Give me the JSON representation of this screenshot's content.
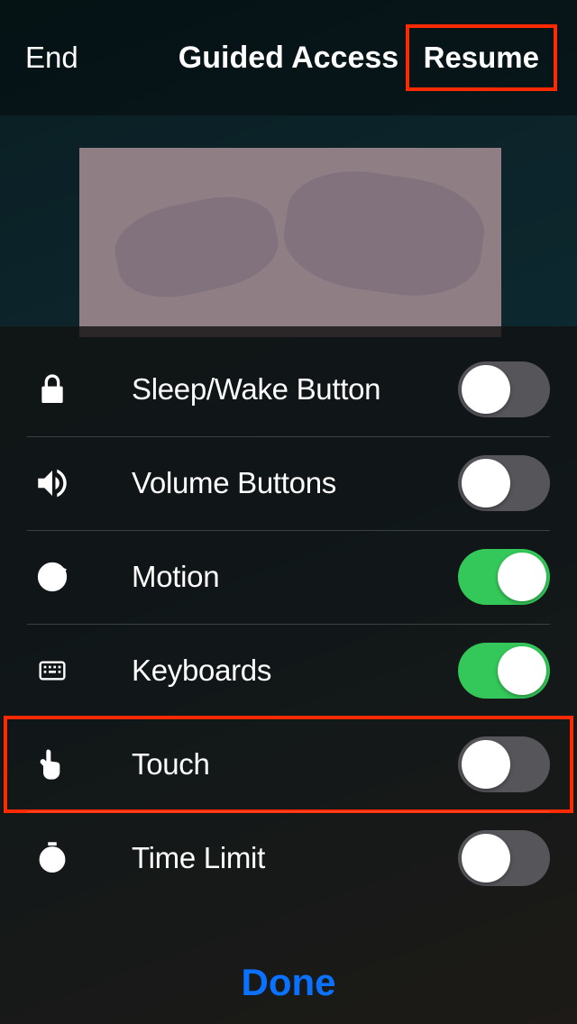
{
  "nav": {
    "end": "End",
    "title": "Guided Access",
    "resume": "Resume"
  },
  "options": [
    {
      "icon": "lock-icon",
      "label": "Sleep/Wake Button",
      "on": false
    },
    {
      "icon": "volume-icon",
      "label": "Volume Buttons",
      "on": false
    },
    {
      "icon": "motion-icon",
      "label": "Motion",
      "on": true
    },
    {
      "icon": "keyboard-icon",
      "label": "Keyboards",
      "on": true
    },
    {
      "icon": "touch-icon",
      "label": "Touch",
      "on": false,
      "highlighted": true
    },
    {
      "icon": "time-icon",
      "label": "Time Limit",
      "on": false
    }
  ],
  "done": "Done",
  "colors": {
    "highlight": "#ff2a00",
    "switch_on": "#34c759",
    "switch_off": "#56555a",
    "done": "#0a72ff"
  }
}
